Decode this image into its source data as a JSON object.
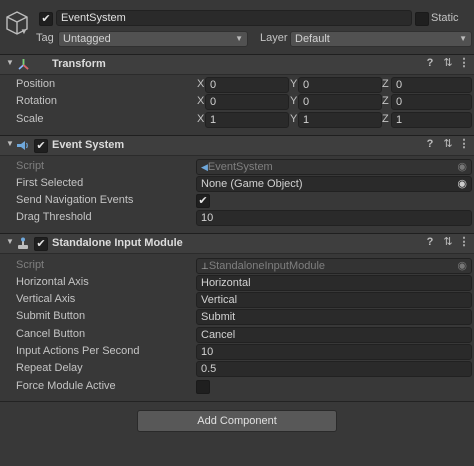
{
  "header": {
    "object_name": "EventSystem",
    "static_label": "Static",
    "tag_label": "Tag",
    "tag_value": "Untagged",
    "layer_label": "Layer",
    "layer_value": "Default"
  },
  "transform": {
    "title": "Transform",
    "rows": [
      {
        "label": "Position",
        "x": "0",
        "y": "0",
        "z": "0"
      },
      {
        "label": "Rotation",
        "x": "0",
        "y": "0",
        "z": "0"
      },
      {
        "label": "Scale",
        "x": "1",
        "y": "1",
        "z": "1"
      }
    ],
    "axis_x": "X",
    "axis_y": "Y",
    "axis_z": "Z"
  },
  "event_system": {
    "title": "Event System",
    "script_label": "Script",
    "script_value": "EventSystem",
    "first_selected_label": "First Selected",
    "first_selected_value": "None (Game Object)",
    "send_nav_label": "Send Navigation Events",
    "send_nav_checked": true,
    "drag_threshold_label": "Drag Threshold",
    "drag_threshold_value": "10"
  },
  "input_module": {
    "title": "Standalone Input Module",
    "script_label": "Script",
    "script_value": "StandaloneInputModule",
    "horizontal_axis_label": "Horizontal Axis",
    "horizontal_axis_value": "Horizontal",
    "vertical_axis_label": "Vertical Axis",
    "vertical_axis_value": "Vertical",
    "submit_label": "Submit Button",
    "submit_value": "Submit",
    "cancel_label": "Cancel Button",
    "cancel_value": "Cancel",
    "input_actions_label": "Input Actions Per Second",
    "input_actions_value": "10",
    "repeat_delay_label": "Repeat Delay",
    "repeat_delay_value": "0.5",
    "force_active_label": "Force Module Active",
    "force_active_checked": false
  },
  "footer": {
    "add_component_label": "Add Component"
  },
  "icons": {
    "checkmark": "✔",
    "help": "?",
    "settings": "⇅",
    "more": "⋮",
    "fold": "▼",
    "target": "◉"
  }
}
